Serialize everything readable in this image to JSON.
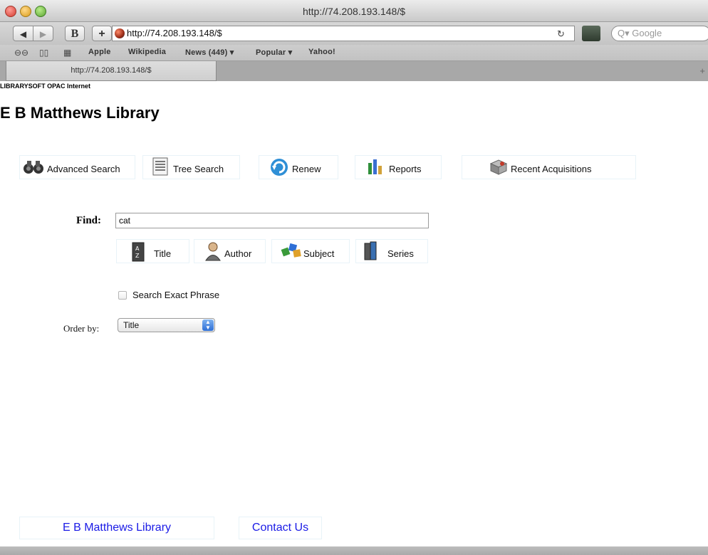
{
  "browser": {
    "window_title": "http://74.208.193.148/$",
    "address": "http://74.208.193.148/$",
    "search_placeholder": "Google",
    "bookmarks": [
      "Apple",
      "Wikipedia",
      "News (449) ▾",
      "Popular ▾",
      "Yahoo!"
    ],
    "tab_label": "http://74.208.193.148/$",
    "buttons": {
      "b": "B",
      "plus": "+"
    }
  },
  "page": {
    "opac_label": "LIBRARYSOFT OPAC Internet",
    "library_title": "E B Matthews Library",
    "nav": [
      {
        "label": "Advanced Search",
        "icon": "binoculars-icon"
      },
      {
        "label": "Tree Search",
        "icon": "tree-document-icon"
      },
      {
        "label": "Renew",
        "icon": "renew-arrow-icon"
      },
      {
        "label": "Reports",
        "icon": "reports-bars-icon"
      },
      {
        "label": "Recent Acquisitions",
        "icon": "box-icon"
      }
    ],
    "find_label": "Find:",
    "find_value": "cat",
    "search_buttons": [
      {
        "label": "Title",
        "icon": "title-book-icon"
      },
      {
        "label": "Author",
        "icon": "author-person-icon"
      },
      {
        "label": "Subject",
        "icon": "subject-puzzle-icon"
      },
      {
        "label": "Series",
        "icon": "series-books-icon"
      }
    ],
    "exact_phrase_label": "Search Exact Phrase",
    "order_label": "Order by:",
    "order_value": "Title",
    "footer": [
      "E B Matthews Library",
      "Contact Us"
    ]
  }
}
